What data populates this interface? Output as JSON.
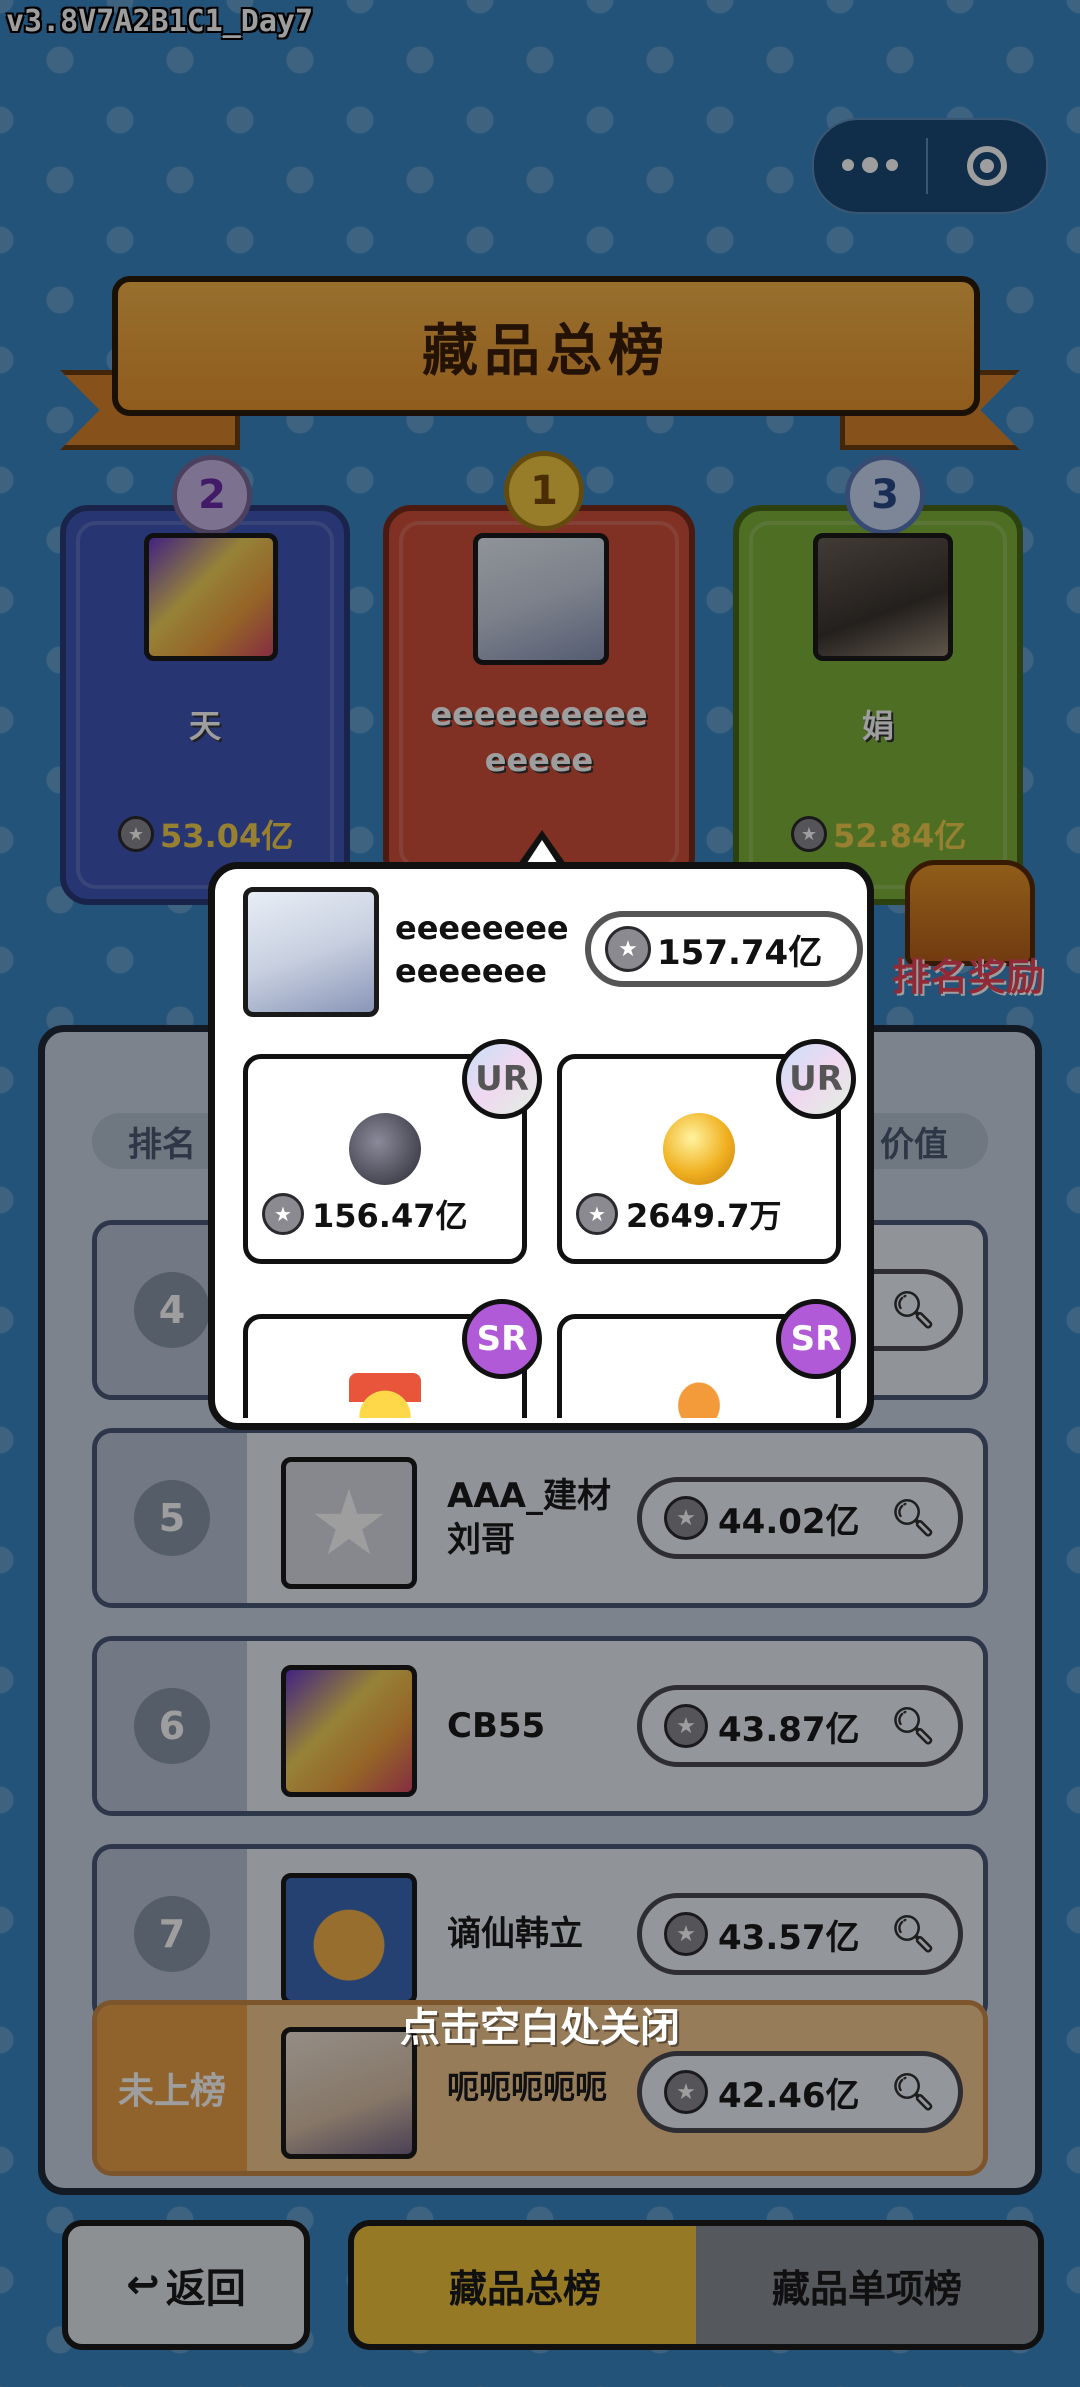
{
  "version": "v3.8V7A2B1C1_Day7",
  "title": "藏品总榜",
  "podium": [
    {
      "rank": "2",
      "name": "天",
      "value": "53.04亿"
    },
    {
      "rank": "1",
      "name": "eeeeeeeeeeeeeee",
      "value": "157.74亿"
    },
    {
      "rank": "3",
      "name": "娟",
      "value": "52.84亿"
    }
  ],
  "reward_label": "排名奖励",
  "columns": {
    "rank": "排名",
    "value": "价值"
  },
  "rows": [
    {
      "rank": "4",
      "name": "",
      "value": ""
    },
    {
      "rank": "5",
      "name": "AAA_建材刘哥",
      "value": "44.02亿"
    },
    {
      "rank": "6",
      "name": "CB55",
      "value": "43.87亿"
    },
    {
      "rank": "7",
      "name": "谪仙韩立",
      "value": "43.57亿"
    }
  ],
  "me_row": {
    "rank": "未上榜",
    "name": "呃呃呃呃呃",
    "value": "42.46亿"
  },
  "close_hint": "点击空白处关闭",
  "popup": {
    "name": "eeeeeeeeeeeeeee",
    "total": "157.74亿",
    "items": [
      {
        "grade": "UR",
        "value": "156.47亿",
        "icon": "dark-figure-icon"
      },
      {
        "grade": "UR",
        "value": "2649.7万",
        "icon": "golden-apple-icon"
      },
      {
        "grade": "SR",
        "value": "",
        "icon": "gold-medal-icon"
      },
      {
        "grade": "SR",
        "value": "",
        "icon": "koi-fish-icon"
      }
    ]
  },
  "buttons": {
    "back": "返回",
    "back_icon": "↩"
  },
  "tabs": [
    {
      "label": "藏品总榜",
      "active": true
    },
    {
      "label": "藏品单项榜",
      "active": false
    }
  ]
}
